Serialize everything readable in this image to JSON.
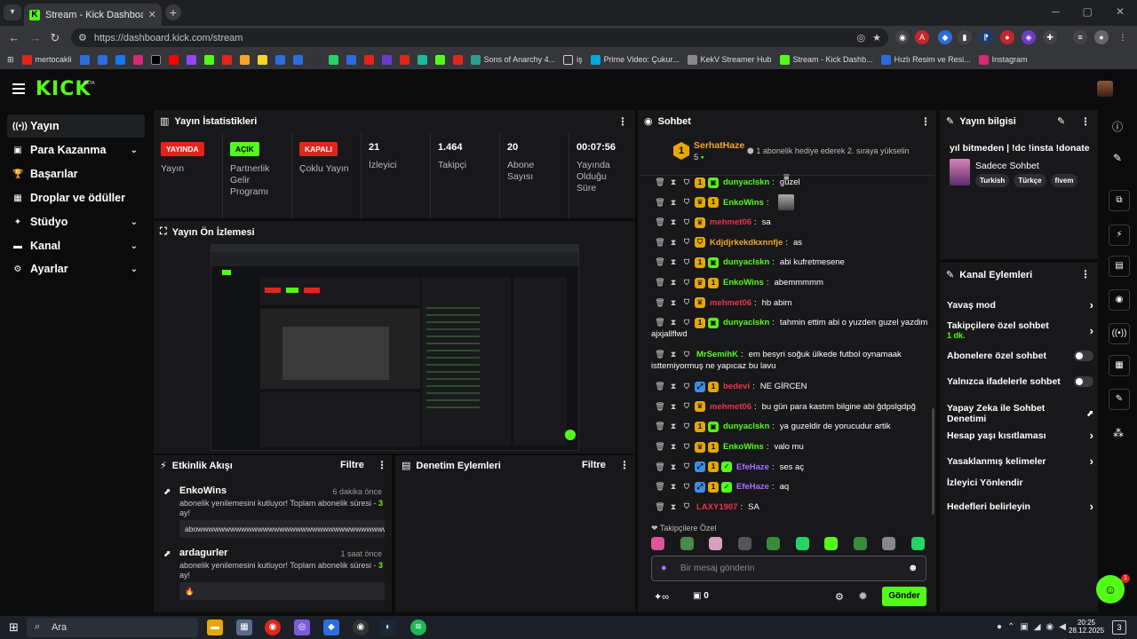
{
  "browser": {
    "tab_title": "Stream - Kick Dashboard",
    "url": "https://dashboard.kick.com/stream",
    "new_tab": "+",
    "win_min": "─",
    "win_max": "▢",
    "win_close": "✕",
    "bookmarks": [
      "mertocakli",
      "Sons of Anarchy 4...",
      "iş",
      "Prime Video: Çukur...",
      "KekV Streamer Hub",
      "Stream - Kick Dashb...",
      "Hızlı Resim ve Resi...",
      "Instagram"
    ]
  },
  "kick": {
    "logo": "KICK",
    "beta": "BETA"
  },
  "sidebar": [
    {
      "label": "Yayın",
      "icon": "broadcast-icon",
      "glyph": "((•))",
      "chevron": false
    },
    {
      "label": "Para Kazanma",
      "icon": "money-icon",
      "glyph": "▣",
      "chevron": true
    },
    {
      "label": "Başarılar",
      "icon": "trophy-icon",
      "glyph": "🏆",
      "chevron": false
    },
    {
      "label": "Droplar ve ödüller",
      "icon": "gift-icon",
      "glyph": "▦",
      "chevron": false
    },
    {
      "label": "Stüdyo",
      "icon": "studio-icon",
      "glyph": "✦",
      "chevron": true
    },
    {
      "label": "Kanal",
      "icon": "channel-icon",
      "glyph": "▬",
      "chevron": true
    },
    {
      "label": "Ayarlar",
      "icon": "settings-icon",
      "glyph": "⚙",
      "chevron": true
    }
  ],
  "stats": {
    "title": "Yayın İstatistikleri",
    "items": [
      {
        "badge": "YAYINDA",
        "badge_color": "#e1251b",
        "label": "Yayın"
      },
      {
        "badge": "AÇIK",
        "badge_color": "#53fc18",
        "label": "Partnerlik Gelir Programı"
      },
      {
        "badge": "KAPALI",
        "badge_color": "#e1251b",
        "label": "Çoklu Yayın"
      },
      {
        "value": "21",
        "label": "İzleyici"
      },
      {
        "value": "1.464",
        "label": "Takipçi"
      },
      {
        "value": "20",
        "label": "Abone Sayısı"
      },
      {
        "value": "00:07:56",
        "label": "Yayında Olduğu Süre"
      }
    ]
  },
  "preview": {
    "title": "Yayın Ön İzlemesi"
  },
  "activity": {
    "title": "Etkinlik Akışı",
    "filter": "Filtre",
    "items": [
      {
        "name": "EnkoWins",
        "time": "6 dakika önce",
        "msg": "abonelik yenilemesini kutluyor! Toplam abonelik süresi -",
        "count": "3",
        "unit": "ay!",
        "box": "abowwwwwwwwwwwwwwwwwwwwwwwwwwwwwwwwwwwwwwww"
      },
      {
        "name": "ardagurler",
        "time": "1 saat önce",
        "msg": "abonelik yenilemesini kutluyor! Toplam abonelik süresi -",
        "count": "3",
        "unit": "ay!",
        "box": "🔥"
      }
    ]
  },
  "moderation": {
    "title": "Denetim Eylemleri",
    "filter": "Filtre"
  },
  "chat": {
    "title": "Sohbet",
    "pinned_user": "SerhatHaze",
    "pinned_rank": "1",
    "pinned_count": "5",
    "pinned_msg": "1 abonelik hediye ederek 2. sıraya yükselin",
    "messages": [
      {
        "user": "dunyaclskn",
        "color": "#53fc18",
        "text": "güzel",
        "badges": [
          "shield",
          "sub1",
          "gift"
        ]
      },
      {
        "user": "EnkoWins",
        "color": "#53fc18",
        "text": "",
        "badges": [
          "shield",
          "crown",
          "sub1"
        ],
        "emote": true
      },
      {
        "user": "mehmet06",
        "color": "#e8344e",
        "text": "sa",
        "badges": [
          "shield",
          "crown"
        ]
      },
      {
        "user": "Kdjdjrkekdkxnnfje",
        "color": "#f5a623",
        "text": "as",
        "badges": [
          "shield",
          "shield2"
        ]
      },
      {
        "user": "dunyaclskn",
        "color": "#53fc18",
        "text": "abi kufretmesene",
        "badges": [
          "shield",
          "sub1",
          "gift"
        ]
      },
      {
        "user": "EnkoWins",
        "color": "#53fc18",
        "text": "abemmmmm",
        "badges": [
          "shield",
          "crown",
          "sub1"
        ]
      },
      {
        "user": "mehmet06",
        "color": "#e8344e",
        "text": "hb abim",
        "badges": [
          "shield",
          "crown"
        ]
      },
      {
        "user": "dunyaclskn",
        "color": "#53fc18",
        "text": "tahmin ettim abi o yuzden guzel yazdim",
        "text2": "ajxjallflwd",
        "badges": [
          "shield",
          "sub1",
          "gift"
        ]
      },
      {
        "user": "MrSemihK",
        "color": "#53fc18",
        "text": "em besyri soğuk ülkede futbol oynamaak",
        "text2": "isttemiyormuş ne yapıcaz bu lavu",
        "badges": [
          "shield"
        ]
      },
      {
        "user": "bedevi",
        "color": "#e8344e",
        "text": "NE GİRCEN",
        "badges": [
          "shield",
          "blue",
          "sub1"
        ]
      },
      {
        "user": "mehmet06",
        "color": "#e8344e",
        "text": "bu gün para kastım bilgine abi ğdpslgdpğ",
        "badges": [
          "shield",
          "crown"
        ]
      },
      {
        "user": "dunyaclskn",
        "color": "#53fc18",
        "text": "ya guzeldir de yorucudur artik",
        "badges": [
          "shield",
          "sub1",
          "gift"
        ]
      },
      {
        "user": "EnkoWins",
        "color": "#53fc18",
        "text": "valo mu",
        "badges": [
          "shield",
          "crown",
          "sub1"
        ]
      },
      {
        "user": "EfeHaze",
        "color": "#a970ff",
        "text": "ses aç",
        "badges": [
          "shield",
          "blue",
          "sub1",
          "verified"
        ]
      },
      {
        "user": "EfeHaze",
        "color": "#a970ff",
        "text": "aq",
        "badges": [
          "shield",
          "blue",
          "sub1",
          "verified"
        ]
      },
      {
        "user": "LAXY1907",
        "color": "#e8344e",
        "text": "SA",
        "badges": [
          "shield"
        ]
      }
    ],
    "follower_emotes_label": "Takipçilere Özel",
    "input_placeholder": "Bir mesaj gönderin",
    "points": "0",
    "send": "Gönder"
  },
  "stream_info": {
    "title": "Yayın bilgisi",
    "stream_title": "yıl bitmeden | !dc !insta !donate",
    "category": "Sadece Sohbet",
    "tags": [
      "Turkish",
      "Türkçe",
      "fivem"
    ]
  },
  "channel_actions": {
    "title": "Kanal Eylemleri",
    "items": [
      {
        "label": "Yavaş mod",
        "type": "arrow"
      },
      {
        "label": "Takipçilere özel sohbet",
        "sub": "1 dk.",
        "type": "arrow"
      },
      {
        "label": "Abonelere özel sohbet",
        "type": "toggle"
      },
      {
        "label": "Yalnızca ifadelerle sohbet",
        "type": "toggle"
      },
      {
        "label": "Yapay Zeka ile Sohbet Denetimi",
        "type": "external"
      },
      {
        "label": "Hesap yaşı kısıtlaması",
        "type": "arrow"
      },
      {
        "label": "Yasaklanmış kelimeler",
        "type": "arrow"
      },
      {
        "label": "İzleyici Yönlendir",
        "type": "none"
      },
      {
        "label": "Hedefleri belirleyin",
        "type": "arrow"
      }
    ]
  },
  "taskbar": {
    "search": "Ara",
    "time": "20:25",
    "date": "28.12.2025",
    "notif_count": "3"
  },
  "support_badge": "1"
}
